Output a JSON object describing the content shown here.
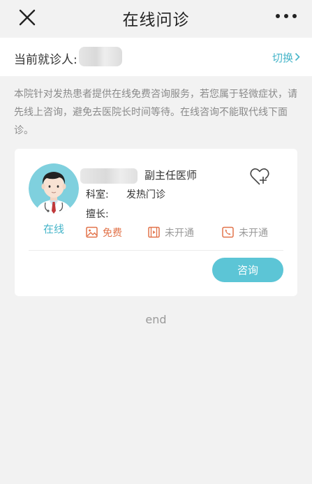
{
  "header": {
    "title": "在线问诊",
    "close_icon": "close-icon",
    "more_icon": "more-icon"
  },
  "patient": {
    "label": "当前就诊人:",
    "switch_label": "切换",
    "accent_color": "#46b5c9"
  },
  "notice": "本院针对发热患者提供在线免费咨询服务，若您属于轻微症状，请先线上咨询，避免去医院长时间等待。在线咨询不能取代线下面诊。",
  "doctor": {
    "title": "副主任医师",
    "dept_label": "科室:",
    "dept_value": "发热门诊",
    "skill_label": "擅长:",
    "status": "在线",
    "services": [
      {
        "icon": "image-icon",
        "label": "免费",
        "color": "#e2734a"
      },
      {
        "icon": "video-icon",
        "label": "未开通",
        "color": "#999999"
      },
      {
        "icon": "phone-icon",
        "label": "未开通",
        "color": "#999999"
      }
    ],
    "consult_button": "咨询",
    "button_color": "#5cc5d6"
  },
  "footer": {
    "end_text": "end"
  }
}
